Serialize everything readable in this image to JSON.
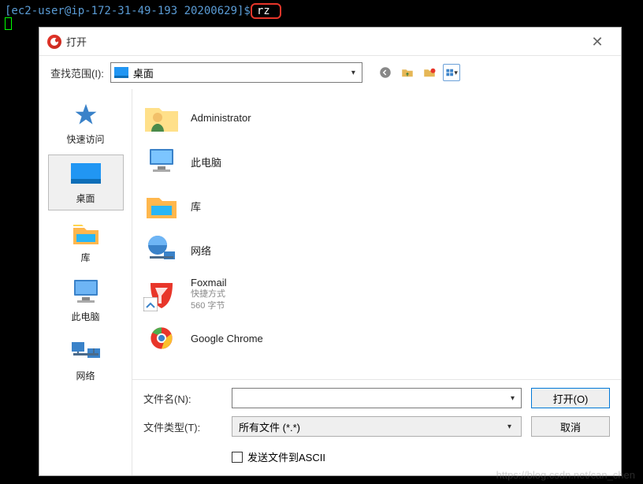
{
  "terminal": {
    "prompt": "[ec2-user@ip-172-31-49-193 20200629]$",
    "command": "rz"
  },
  "dialog": {
    "title": "打开",
    "close_tooltip": "关闭"
  },
  "lookin": {
    "label": "查找范围(I):",
    "selected": "桌面"
  },
  "toolbar_icons": [
    "back-icon",
    "up-icon",
    "new-folder-icon",
    "view-icon"
  ],
  "sidebar": {
    "items": [
      {
        "id": "quick-access",
        "label": "快速访问"
      },
      {
        "id": "desktop",
        "label": "桌面",
        "selected": true
      },
      {
        "id": "libraries",
        "label": "库"
      },
      {
        "id": "this-pc",
        "label": "此电脑"
      },
      {
        "id": "network",
        "label": "网络"
      }
    ]
  },
  "files": {
    "items": [
      {
        "id": "administrator",
        "name": "Administrator",
        "type": "user"
      },
      {
        "id": "this-pc",
        "name": "此电脑",
        "type": "computer"
      },
      {
        "id": "libraries",
        "name": "库",
        "type": "library"
      },
      {
        "id": "network",
        "name": "网络",
        "type": "network"
      },
      {
        "id": "foxmail",
        "name": "Foxmail",
        "sub1": "快捷方式",
        "sub2": "560 字节",
        "type": "foxmail"
      },
      {
        "id": "chrome",
        "name": "Google Chrome",
        "type": "chrome"
      }
    ]
  },
  "form": {
    "filename_label": "文件名(N):",
    "filetype_label": "文件类型(T):",
    "filetype_value": "所有文件 (*.*)",
    "open_button": "打开(O)",
    "cancel_button": "取消",
    "ascii_checkbox": "发送文件到ASCII"
  },
  "watermark": "https://blog.csdn.net/can_chen"
}
